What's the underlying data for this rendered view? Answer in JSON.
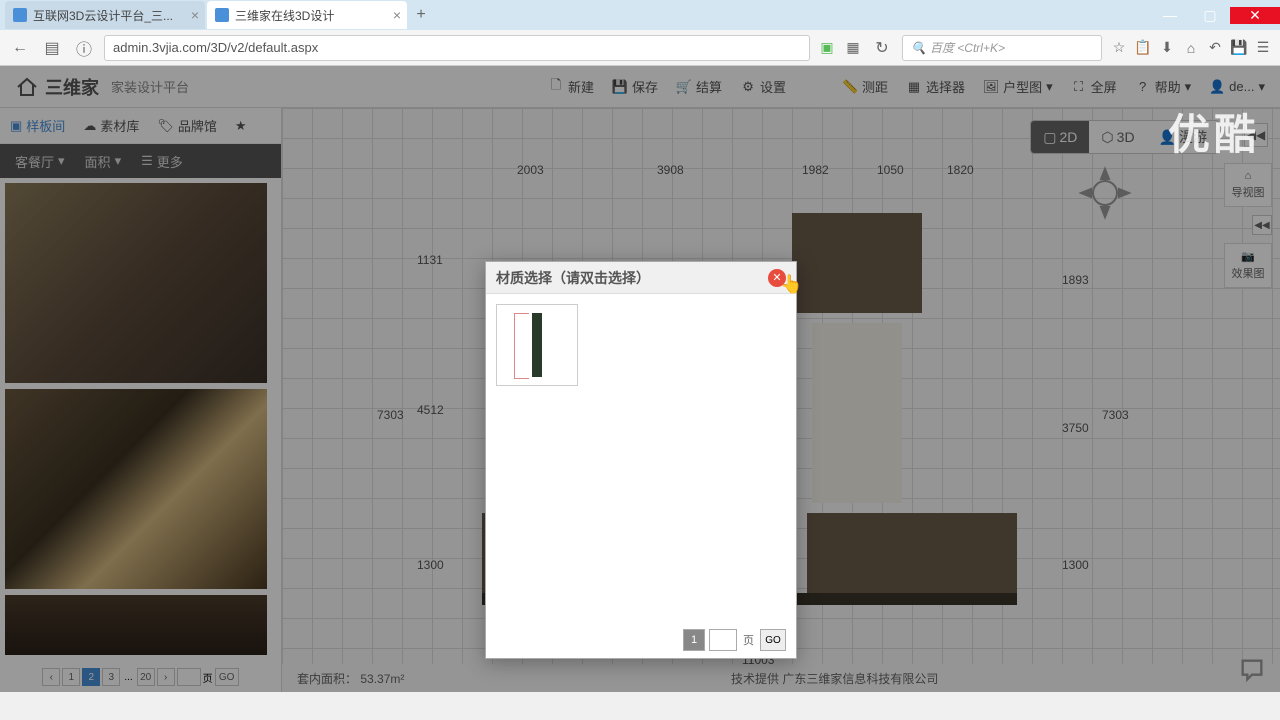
{
  "window": {
    "min": "—",
    "max": "▢",
    "close": "✕"
  },
  "tabs": [
    {
      "title": "互联网3D云设计平台_三..."
    },
    {
      "title": "三维家在线3D设计"
    }
  ],
  "url": "admin.3vjia.com/3D/v2/default.aspx",
  "search_placeholder": "百度 <Ctrl+K>",
  "header": {
    "logo_text": "三维家",
    "platform": "家装设计平台",
    "buttons": {
      "new": "新建",
      "save": "保存",
      "finish": "结算",
      "settings": "设置",
      "measure": "测距",
      "selector": "选择器",
      "floorplan": "户型图",
      "fullscreen": "全屏",
      "help": "帮助",
      "user": "de..."
    }
  },
  "sidebar": {
    "tabs": {
      "sample": "样板间",
      "material": "素材库",
      "brand": "品牌馆"
    },
    "filters": {
      "room": "客餐厅",
      "area": "面积",
      "more": "更多"
    },
    "pager": {
      "p1": "1",
      "p2": "2",
      "p3": "3",
      "dots": "...",
      "last": "20",
      "go": "GO"
    }
  },
  "view": {
    "btn2d": "2D",
    "btn3d": "3D",
    "roam": "漫游"
  },
  "right_panel": {
    "nav": "导视图",
    "effect": "效果图"
  },
  "dimensions": {
    "top1": "2003",
    "top2": "3908",
    "top3": "1982",
    "top4": "1050",
    "top5": "1820",
    "left1": "1131",
    "left2": "4512",
    "left_total": "7303",
    "right1": "1893",
    "right2": "3750",
    "right_total": "7303",
    "inner1": "1300",
    "inner2": "1300",
    "bottom": "11003"
  },
  "status": {
    "area_label": "套内面积：",
    "area_value": "53.37m²",
    "provider": "技术提供 广东三维家信息科技有限公司"
  },
  "modal": {
    "title": "材质选择（请双击选择）",
    "page": "1",
    "page_label": "页",
    "go": "GO"
  },
  "watermark": "优酷"
}
